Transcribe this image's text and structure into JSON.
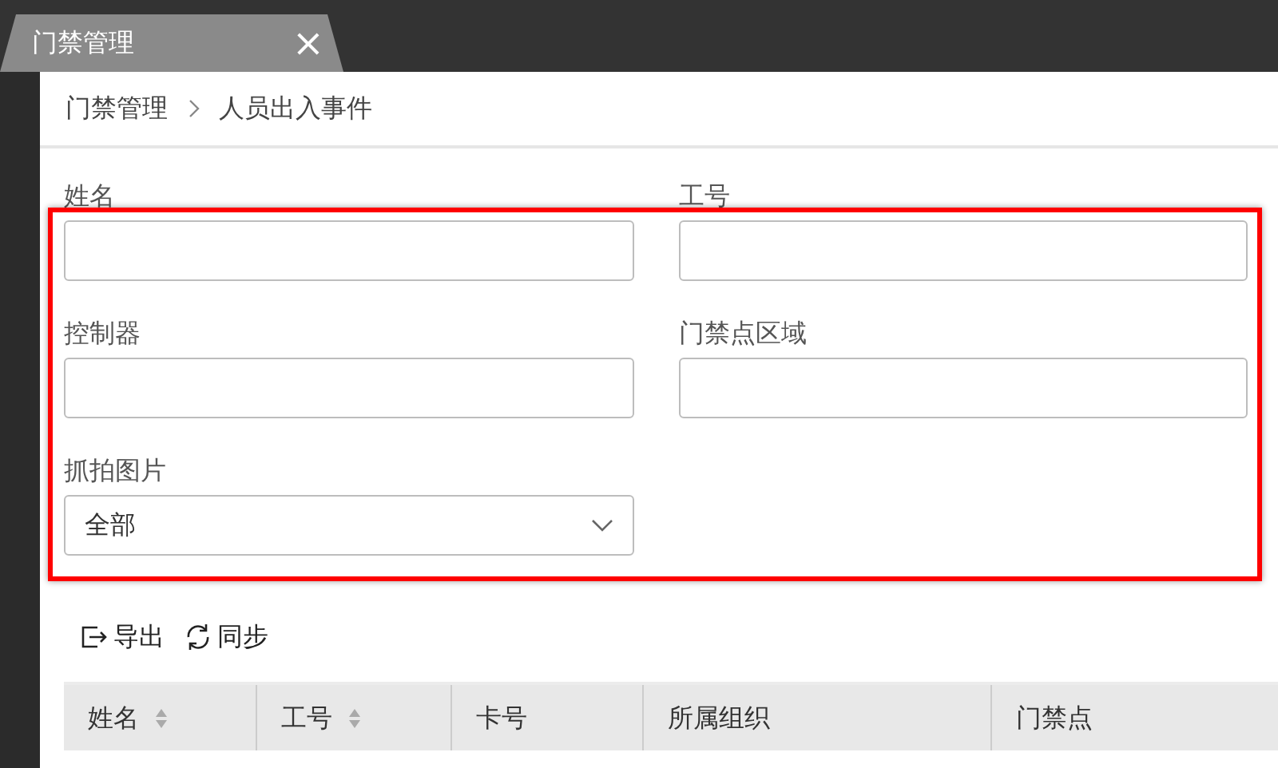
{
  "tab": {
    "title": "门禁管理",
    "close": "×"
  },
  "breadcrumb": [
    "门禁管理",
    "人员出入事件"
  ],
  "fields": [
    {
      "label": "姓名",
      "kind": "text"
    },
    {
      "label": "工号",
      "kind": "text"
    },
    {
      "label": "控制器",
      "kind": "text"
    },
    {
      "label": "门禁点区域",
      "kind": "text"
    },
    {
      "label": "抓拍图片",
      "kind": "select",
      "value": "全部"
    }
  ],
  "highlight": {
    "color": "#ff0000"
  },
  "toolbar": [
    {
      "label": "导出",
      "kind": "export"
    },
    {
      "label": "同步",
      "kind": "sync"
    }
  ],
  "table": {
    "columns": [
      {
        "label": "姓名",
        "sortable": true
      },
      {
        "label": "工号",
        "sortable": true
      },
      {
        "label": "卡号",
        "sortable": false
      },
      {
        "label": "所属组织",
        "sortable": false
      },
      {
        "label": "门禁点",
        "sortable": false
      }
    ]
  }
}
